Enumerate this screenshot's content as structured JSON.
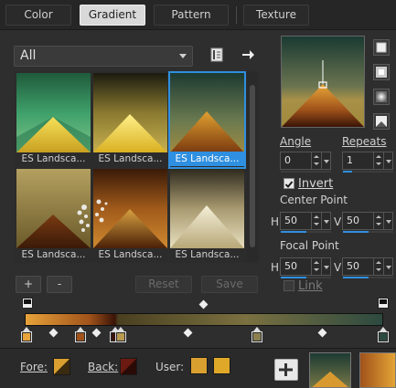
{
  "tabs": [
    {
      "label": "Color",
      "active": false
    },
    {
      "label": "Gradient",
      "active": true
    },
    {
      "label": "Pattern",
      "active": false
    },
    {
      "label": "Texture",
      "active": false
    }
  ],
  "category_dropdown": {
    "value": "All"
  },
  "gallery": {
    "items": [
      {
        "caption": "ES Landsca...",
        "selected": false
      },
      {
        "caption": "ES Landsca...",
        "selected": false
      },
      {
        "caption": "ES Landsca...",
        "selected": true
      },
      {
        "caption": "ES Landsca...",
        "selected": false
      },
      {
        "caption": "ES Landsca...",
        "selected": false
      },
      {
        "caption": "ES Landsca...",
        "selected": false
      }
    ]
  },
  "buttons": {
    "add": "+",
    "remove": "-",
    "reset": "Reset",
    "save": "Save"
  },
  "bottom": {
    "fore_label": "Fore:",
    "back_label": "Back:",
    "user_label": "User:"
  },
  "controls": {
    "angle_label": "Angle",
    "angle_value": "0",
    "repeats_label": "Repeats",
    "repeats_value": "1",
    "invert_label": "Invert",
    "invert_checked": true,
    "center_point_label": "Center Point",
    "center_h_label": "H",
    "center_h_value": "50",
    "center_v_label": "V",
    "center_v_value": "50",
    "focal_point_label": "Focal Point",
    "focal_h_label": "H",
    "focal_h_value": "50",
    "focal_v_label": "V",
    "focal_v_value": "50",
    "link_label": "Link",
    "link_checked": false
  },
  "colors": {
    "accent": "#2f8fe0",
    "fore_swatch": "#d9a030",
    "back_swatch": "#5a1a10",
    "user_swatch_1": "#d9a030",
    "user_swatch_2": "#e0a828"
  },
  "icons": {
    "save_preset": "book-save-icon",
    "export": "arrow-right-icon",
    "add_stop": "plus-icon"
  }
}
